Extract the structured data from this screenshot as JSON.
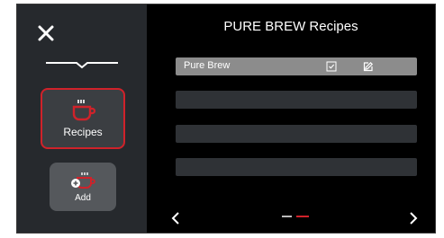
{
  "window": {
    "title": "PURE BREW Recipes",
    "close_icon": "close-icon"
  },
  "sidebar": {
    "items": [
      {
        "label": "Recipes",
        "icon": "coffee-cup-icon",
        "active": true
      },
      {
        "label": "Add",
        "icon": "add-coffee-cup-icon",
        "active": false
      }
    ]
  },
  "recipes": {
    "rows": [
      {
        "label": "Pure Brew",
        "selected": true
      },
      {
        "label": "",
        "selected": false
      },
      {
        "label": "",
        "selected": false
      },
      {
        "label": "",
        "selected": false
      }
    ],
    "row_icons": [
      "checkbox-icon",
      "edit-icon"
    ]
  },
  "pagination": {
    "prev_icon": "chevron-left-icon",
    "next_icon": "chevron-right-icon",
    "page_count": 2,
    "current_page": 2
  },
  "colors": {
    "accent": "#d0222a",
    "sidebar_bg": "#26292d",
    "panel_bg": "#000000",
    "selected_row": "#8c8c8c",
    "empty_row": "#2f3236"
  }
}
